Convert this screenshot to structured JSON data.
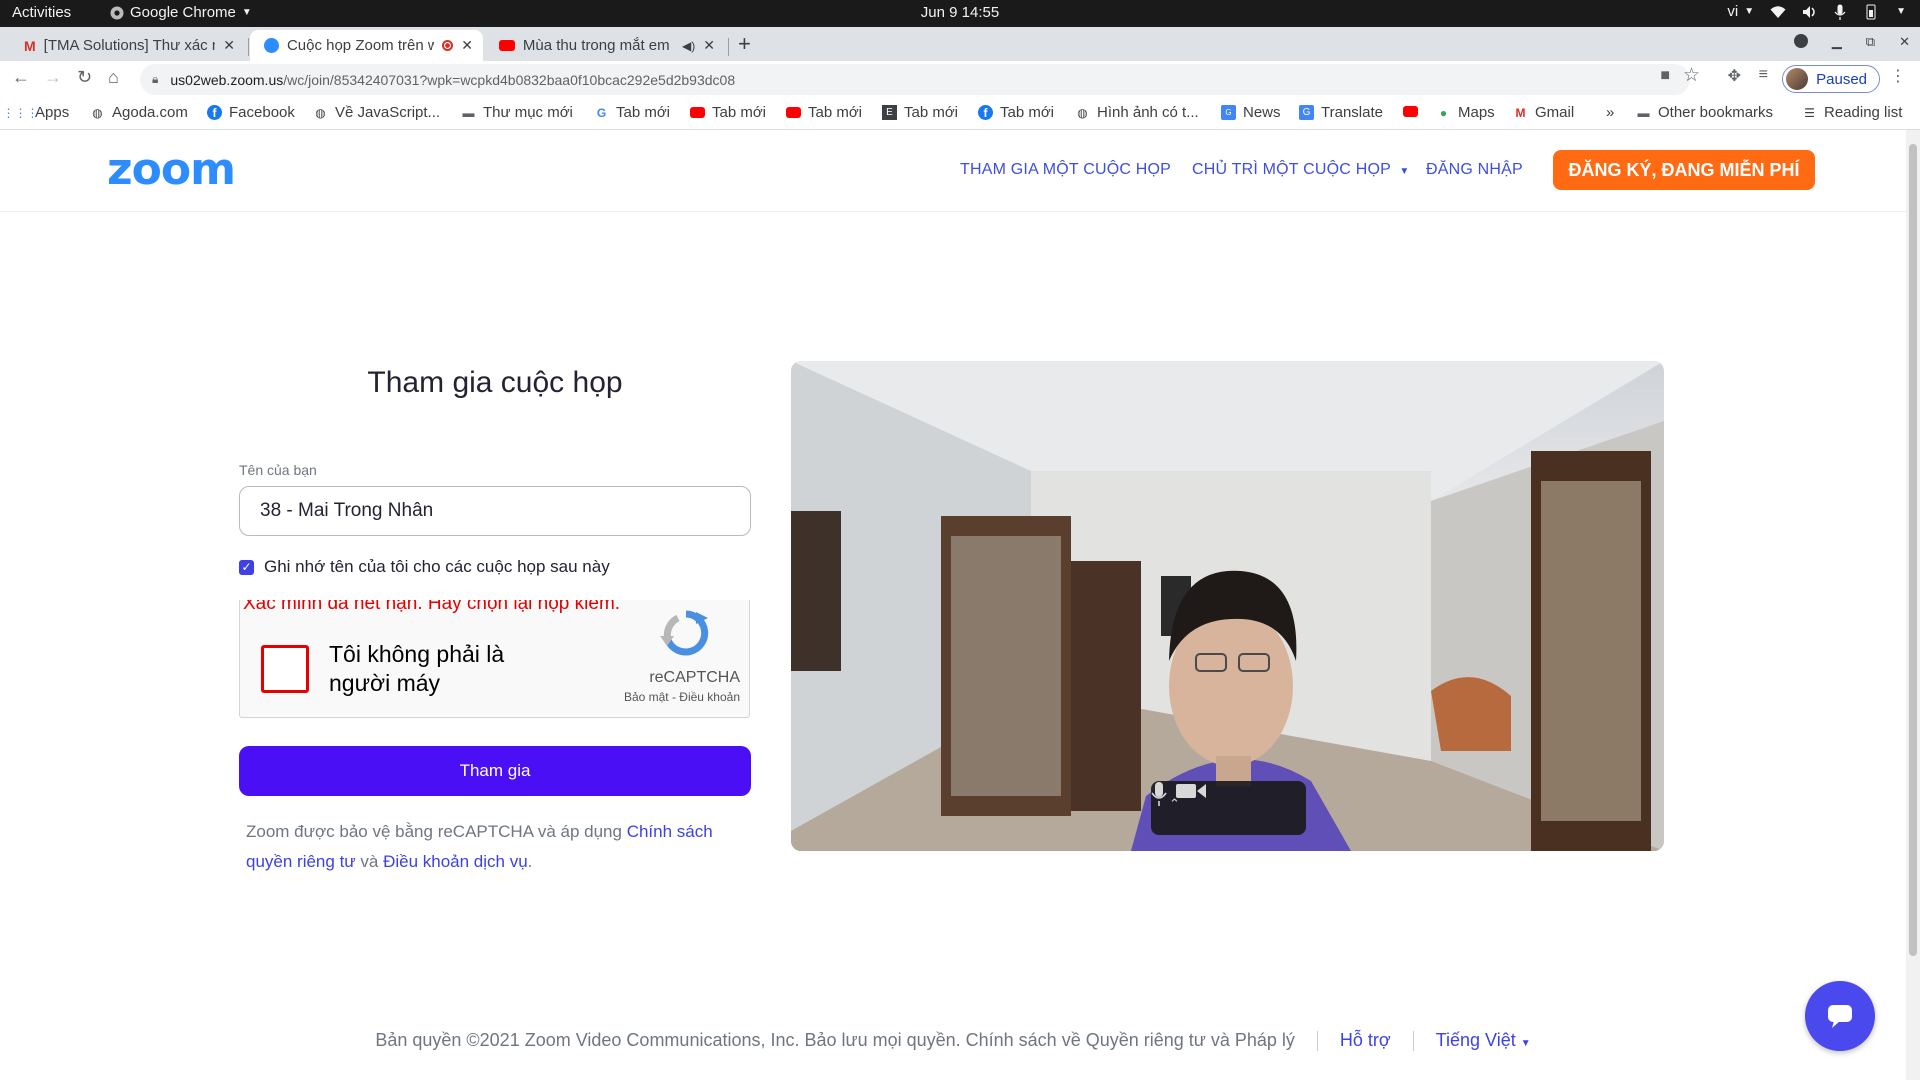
{
  "system": {
    "activities": "Activities",
    "app_name": "Google Chrome",
    "clock": "Jun 9  14:55",
    "input_lang": "vi"
  },
  "tabs": [
    {
      "title": "[TMA Solutions] Thư xác nhận",
      "icon": "gmail-icon",
      "active": false
    },
    {
      "title": "Cuộc họp Zoom trên web",
      "icon": "zoom-icon",
      "active": true,
      "recording": true
    },
    {
      "title": "Mùa thu trong mắt em",
      "icon": "youtube-icon",
      "active": false,
      "audio": true
    }
  ],
  "toolbar": {
    "url_host": "us02web.zoom.us",
    "url_path": "/wc/join/85342407031?wpk=wcpkd4b0832baa0f10bcac292e5d2b93dc08",
    "profile_status": "Paused"
  },
  "bookmarks": [
    {
      "label": "Apps",
      "icon": "apps-grid-icon"
    },
    {
      "label": "Agoda.com",
      "icon": "globe-icon"
    },
    {
      "label": "Facebook",
      "icon": "facebook-icon"
    },
    {
      "label": "Về JavaScript...",
      "icon": "globe-icon"
    },
    {
      "label": "Thư mục mới",
      "icon": "folder-icon"
    },
    {
      "label": "Tab mới",
      "icon": "google-icon"
    },
    {
      "label": "Tab mới",
      "icon": "youtube-icon"
    },
    {
      "label": "Tab mới",
      "icon": "youtube-icon"
    },
    {
      "label": "Tab mới",
      "icon": "evernote-icon"
    },
    {
      "label": "Tab mới",
      "icon": "facebook-icon"
    },
    {
      "label": "Hình ảnh có t...",
      "icon": "globe-icon"
    },
    {
      "label": "News",
      "icon": "news-icon"
    },
    {
      "label": "Translate",
      "icon": "translate-icon"
    },
    {
      "label": "",
      "icon": "youtube-icon"
    },
    {
      "label": "Maps",
      "icon": "maps-icon"
    },
    {
      "label": "Gmail",
      "icon": "gmail-icon"
    }
  ],
  "bookmarks_overflow": "»",
  "other_bookmarks": "Other bookmarks",
  "reading_list": "Reading list",
  "zoom": {
    "logo": "zoom",
    "nav": {
      "join": "THAM GIA MỘT CUỘC HỌP",
      "host": "CHỦ TRÌ MỘT CUỘC HỌP",
      "signin": "ĐĂNG NHẬP",
      "signup": "ĐĂNG KÝ, ĐANG MIỄN PHÍ"
    },
    "form": {
      "title": "Tham gia cuộc họp",
      "name_label": "Tên của bạn",
      "name_value": "38 - Mai Trong Nhân",
      "remember_label": "Ghi nhớ tên của tôi cho các cuộc họp sau này",
      "remember_checked": true,
      "join_button": "Tham gia",
      "legal_prefix": "Zoom được bảo vệ bằng reCAPTCHA và áp dụng ",
      "privacy_link": "Chính sách quyền riêng tư",
      "legal_and": " và ",
      "terms_link": "Điều khoản dịch vụ",
      "legal_suffix": "."
    },
    "captcha": {
      "error": "Xác minh đã hết hạn. Hãy chọn lại hộp kiểm.",
      "label": "Tôi không phải là người máy",
      "brand": "reCAPTCHA",
      "terms": "Bảo mật - Điều khoản"
    },
    "footer": {
      "copyright": "Bản quyền ©2021 Zoom Video Communications, Inc. Bảo lưu mọi quyền. Chính sách về Quyền riêng tư và Pháp lý",
      "support": "Hỗ trợ",
      "language": "Tiếng Việt"
    }
  },
  "colors": {
    "zoom_blue": "#2d8cff",
    "nav_link": "#3d4ee3",
    "signup_orange": "#ff6a13",
    "join_purple": "#4a0ff5",
    "captcha_error": "#e60000"
  }
}
